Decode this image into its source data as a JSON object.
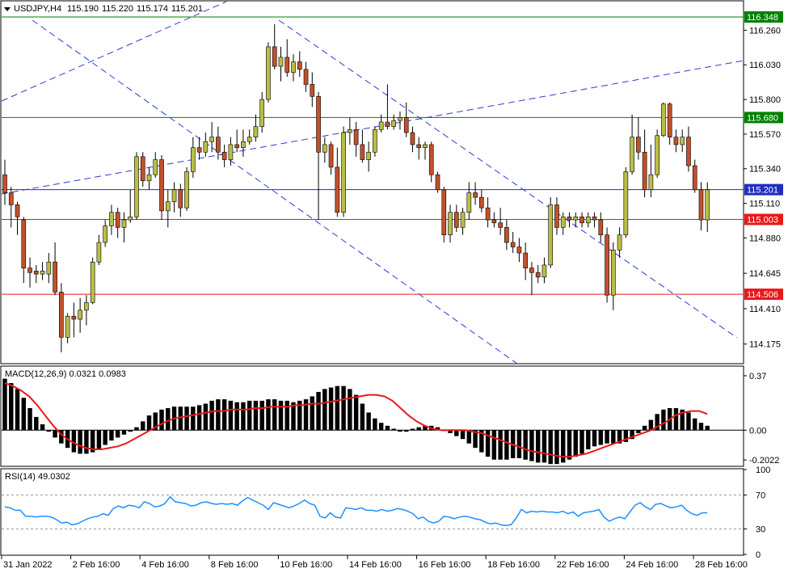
{
  "header": {
    "symbol": "USDJPY,H4",
    "open": "115.190",
    "high": "115.220",
    "low": "115.174",
    "close": "115.201"
  },
  "colors": {
    "bull": "#b9bf45",
    "bear": "#c2512b",
    "wick": "#000000",
    "support_green": "#008000",
    "red_line": "#e8191a",
    "blue_line": "#1f2fbf",
    "trend_dash": "#2b3bd6",
    "macd_hist": "#000000",
    "macd_signal": "#e8191a",
    "rsi_line": "#1e90ff"
  },
  "chart_data": [
    {
      "type": "candlestick",
      "title": "USDJPY,H4",
      "ylim": [
        114.05,
        116.45
      ],
      "y_ticks": [
        "116.260",
        "116.030",
        "115.800",
        "115.570",
        "115.340",
        "115.110",
        "114.880",
        "114.645",
        "114.410",
        "114.175"
      ],
      "x_tick_labels": [
        "31 Jan 2022",
        "2 Feb 16:00",
        "4 Feb 16:00",
        "8 Feb 16:00",
        "10 Feb 16:00",
        "14 Feb 16:00",
        "16 Feb 16:00",
        "18 Feb 16:00",
        "22 Feb 16:00",
        "24 Feb 16:00",
        "28 Feb 16:00"
      ],
      "horizontal_levels": [
        {
          "value": 116.348,
          "label": "116.348",
          "color": "support_green"
        },
        {
          "value": 115.68,
          "label": "115.680",
          "color": "support_green"
        },
        {
          "value": 115.201,
          "label": "115.201",
          "color": "blue_line"
        },
        {
          "value": 115.003,
          "label": "115.003",
          "color": "red_line"
        },
        {
          "value": 114.506,
          "label": "114.506",
          "color": "red_line"
        }
      ],
      "candles": [
        [
          115.3,
          115.4,
          115.1,
          115.18
        ],
        [
          115.18,
          115.22,
          114.95,
          115.1
        ],
        [
          115.1,
          115.12,
          114.9,
          115.02
        ],
        [
          115.0,
          115.02,
          114.58,
          114.68
        ],
        [
          114.68,
          114.75,
          114.55,
          114.65
        ],
        [
          114.66,
          114.7,
          114.58,
          114.64
        ],
        [
          114.64,
          114.72,
          114.6,
          114.66
        ],
        [
          114.64,
          114.78,
          114.58,
          114.72
        ],
        [
          114.72,
          114.85,
          114.5,
          114.52
        ],
        [
          114.52,
          114.58,
          114.12,
          114.22
        ],
        [
          114.22,
          114.38,
          114.18,
          114.36
        ],
        [
          114.36,
          114.45,
          114.22,
          114.34
        ],
        [
          114.34,
          114.48,
          114.25,
          114.4
        ],
        [
          114.4,
          114.5,
          114.3,
          114.45
        ],
        [
          114.45,
          114.75,
          114.44,
          114.72
        ],
        [
          114.72,
          114.9,
          114.7,
          114.85
        ],
        [
          114.85,
          115.0,
          114.82,
          114.96
        ],
        [
          114.96,
          115.1,
          114.9,
          115.05
        ],
        [
          115.05,
          115.08,
          114.88,
          114.95
        ],
        [
          114.95,
          115.05,
          114.85,
          115.0
        ],
        [
          115.0,
          115.2,
          114.98,
          115.02
        ],
        [
          115.02,
          115.45,
          115.0,
          115.42
        ],
        [
          115.42,
          115.45,
          115.22,
          115.26
        ],
        [
          115.26,
          115.35,
          115.2,
          115.3
        ],
        [
          115.3,
          115.45,
          115.28,
          115.4
        ],
        [
          115.4,
          115.43,
          115.0,
          115.06
        ],
        [
          115.06,
          115.2,
          114.95,
          115.12
        ],
        [
          115.12,
          115.25,
          115.05,
          115.2
        ],
        [
          115.2,
          115.24,
          115.02,
          115.08
        ],
        [
          115.08,
          115.35,
          115.06,
          115.32
        ],
        [
          115.32,
          115.55,
          115.28,
          115.48
        ],
        [
          115.48,
          115.55,
          115.4,
          115.45
        ],
        [
          115.45,
          115.58,
          115.42,
          115.52
        ],
        [
          115.52,
          115.65,
          115.45,
          115.55
        ],
        [
          115.55,
          115.62,
          115.4,
          115.45
        ],
        [
          115.45,
          115.5,
          115.35,
          115.4
        ],
        [
          115.4,
          115.55,
          115.36,
          115.5
        ],
        [
          115.5,
          115.6,
          115.45,
          115.48
        ],
        [
          115.48,
          115.6,
          115.42,
          115.52
        ],
        [
          115.52,
          115.6,
          115.5,
          115.55
        ],
        [
          115.55,
          115.7,
          115.52,
          115.62
        ],
        [
          115.62,
          115.85,
          115.58,
          115.8
        ],
        [
          115.8,
          116.18,
          115.78,
          116.15
        ],
        [
          116.15,
          116.3,
          116.0,
          116.02
        ],
        [
          116.02,
          116.15,
          115.92,
          116.08
        ],
        [
          116.08,
          116.2,
          115.95,
          115.98
        ],
        [
          115.98,
          116.1,
          115.92,
          116.05
        ],
        [
          116.05,
          116.12,
          115.95,
          116.0
        ],
        [
          116.0,
          116.05,
          115.85,
          115.9
        ],
        [
          115.9,
          115.98,
          115.75,
          115.82
        ],
        [
          115.82,
          115.85,
          115.0,
          115.45
        ],
        [
          115.45,
          115.55,
          115.38,
          115.5
        ],
        [
          115.5,
          115.52,
          115.3,
          115.35
        ],
        [
          115.35,
          115.48,
          115.02,
          115.05
        ],
        [
          115.05,
          115.62,
          115.02,
          115.58
        ],
        [
          115.58,
          115.68,
          115.5,
          115.6
        ],
        [
          115.6,
          115.65,
          115.42,
          115.5
        ],
        [
          115.5,
          115.6,
          115.38,
          115.4
        ],
        [
          115.4,
          115.52,
          115.32,
          115.45
        ],
        [
          115.45,
          115.62,
          115.42,
          115.6
        ],
        [
          115.6,
          115.7,
          115.58,
          115.65
        ],
        [
          115.65,
          115.9,
          115.6,
          115.62
        ],
        [
          115.62,
          115.7,
          115.6,
          115.66
        ],
        [
          115.66,
          115.72,
          115.6,
          115.68
        ],
        [
          115.68,
          115.78,
          115.55,
          115.58
        ],
        [
          115.58,
          115.62,
          115.45,
          115.5
        ],
        [
          115.5,
          115.55,
          115.4,
          115.48
        ],
        [
          115.48,
          115.52,
          115.4,
          115.5
        ],
        [
          115.5,
          115.52,
          115.25,
          115.3
        ],
        [
          115.3,
          115.32,
          115.18,
          115.2
        ],
        [
          115.2,
          115.22,
          114.85,
          114.9
        ],
        [
          114.9,
          115.1,
          114.85,
          115.05
        ],
        [
          115.05,
          115.1,
          114.92,
          114.95
        ],
        [
          114.95,
          115.08,
          114.9,
          115.05
        ],
        [
          115.05,
          115.25,
          115.0,
          115.18
        ],
        [
          115.18,
          115.25,
          115.1,
          115.15
        ],
        [
          115.15,
          115.2,
          115.05,
          115.08
        ],
        [
          115.08,
          115.15,
          114.95,
          115.0
        ],
        [
          115.0,
          115.05,
          114.95,
          114.98
        ],
        [
          114.98,
          115.08,
          114.9,
          114.95
        ],
        [
          114.95,
          115.0,
          114.8,
          114.85
        ],
        [
          114.85,
          114.92,
          114.78,
          114.82
        ],
        [
          114.82,
          114.88,
          114.72,
          114.78
        ],
        [
          114.78,
          114.85,
          114.6,
          114.68
        ],
        [
          114.68,
          114.72,
          114.5,
          114.65
        ],
        [
          114.65,
          114.7,
          114.58,
          114.62
        ],
        [
          114.62,
          114.75,
          114.58,
          114.7
        ],
        [
          114.7,
          115.15,
          114.68,
          115.1
        ],
        [
          115.1,
          115.15,
          114.9,
          114.95
        ],
        [
          114.95,
          115.05,
          114.9,
          115.02
        ],
        [
          115.02,
          115.05,
          114.95,
          115.0
        ],
        [
          115.0,
          115.05,
          114.95,
          115.02
        ],
        [
          115.02,
          115.05,
          114.95,
          114.98
        ],
        [
          114.98,
          115.05,
          114.95,
          115.02
        ],
        [
          115.02,
          115.05,
          114.95,
          115.0
        ],
        [
          115.0,
          115.05,
          114.85,
          114.9
        ],
        [
          114.9,
          114.95,
          114.45,
          114.5
        ],
        [
          114.5,
          114.85,
          114.4,
          114.8
        ],
        [
          114.8,
          114.95,
          114.75,
          114.9
        ],
        [
          114.9,
          115.35,
          114.88,
          115.32
        ],
        [
          115.32,
          115.7,
          115.3,
          115.55
        ],
        [
          115.55,
          115.68,
          115.4,
          115.45
        ],
        [
          115.45,
          115.6,
          115.15,
          115.2
        ],
        [
          115.2,
          115.5,
          115.15,
          115.3
        ],
        [
          115.3,
          115.6,
          115.28,
          115.56
        ],
        [
          115.56,
          115.78,
          115.55,
          115.77
        ],
        [
          115.77,
          115.78,
          115.5,
          115.55
        ],
        [
          115.55,
          115.6,
          115.45,
          115.5
        ],
        [
          115.5,
          115.6,
          115.45,
          115.55
        ],
        [
          115.55,
          115.62,
          115.32,
          115.36
        ],
        [
          115.36,
          115.4,
          115.18,
          115.2
        ],
        [
          115.2,
          115.25,
          114.93,
          115.0
        ],
        [
          115.0,
          115.25,
          114.92,
          115.2
        ]
      ]
    },
    {
      "type": "bar",
      "title": "MACD(12,26,9) 0.0321 0.0983",
      "ylim": [
        -0.24,
        0.43
      ],
      "y_ticks": [
        "0.37",
        "0.00",
        "-0.2022"
      ],
      "hist": [
        0.35,
        0.32,
        0.28,
        0.22,
        0.15,
        0.09,
        0.04,
        -0.01,
        -0.05,
        -0.09,
        -0.12,
        -0.15,
        -0.16,
        -0.16,
        -0.15,
        -0.13,
        -0.1,
        -0.07,
        -0.05,
        -0.03,
        -0.01,
        0.02,
        0.06,
        0.1,
        0.12,
        0.14,
        0.15,
        0.16,
        0.16,
        0.16,
        0.16,
        0.17,
        0.18,
        0.2,
        0.21,
        0.21,
        0.2,
        0.19,
        0.19,
        0.2,
        0.2,
        0.2,
        0.21,
        0.21,
        0.2,
        0.2,
        0.19,
        0.2,
        0.21,
        0.23,
        0.26,
        0.28,
        0.29,
        0.3,
        0.3,
        0.28,
        0.24,
        0.18,
        0.12,
        0.08,
        0.05,
        0.03,
        0.01,
        -0.01,
        -0.01,
        0.01,
        0.02,
        0.03,
        0.03,
        0.02,
        0.0,
        -0.02,
        -0.04,
        -0.06,
        -0.09,
        -0.12,
        -0.15,
        -0.18,
        -0.2,
        -0.2,
        -0.2,
        -0.19,
        -0.19,
        -0.2,
        -0.21,
        -0.22,
        -0.22,
        -0.23,
        -0.23,
        -0.22,
        -0.2,
        -0.18,
        -0.16,
        -0.13,
        -0.11,
        -0.1,
        -0.09,
        -0.09,
        -0.09,
        -0.08,
        -0.06,
        -0.02,
        0.03,
        0.07,
        0.11,
        0.14,
        0.15,
        0.15,
        0.14,
        0.12,
        0.08,
        0.05,
        0.03
      ],
      "signal": [
        0.32,
        0.3,
        0.27,
        0.23,
        0.17,
        0.1,
        0.03,
        -0.03,
        -0.07,
        -0.1,
        -0.12,
        -0.13,
        -0.13,
        -0.12,
        -0.11,
        -0.09,
        -0.06,
        -0.03,
        0.0,
        0.03,
        0.06,
        0.08,
        0.09,
        0.1,
        0.11,
        0.12,
        0.13,
        0.13,
        0.14,
        0.14,
        0.14,
        0.15,
        0.15,
        0.16,
        0.16,
        0.16,
        0.17,
        0.17,
        0.18,
        0.18,
        0.19,
        0.2,
        0.21,
        0.22,
        0.23,
        0.24,
        0.24,
        0.23,
        0.2,
        0.15,
        0.1,
        0.06,
        0.03,
        0.01,
        0.0,
        0.0,
        0.0,
        0.0,
        -0.01,
        -0.02,
        -0.04,
        -0.06,
        -0.08,
        -0.1,
        -0.12,
        -0.14,
        -0.15,
        -0.16,
        -0.17,
        -0.18,
        -0.18,
        -0.17,
        -0.16,
        -0.14,
        -0.12,
        -0.1,
        -0.08,
        -0.06,
        -0.04,
        -0.02,
        0.0,
        0.03,
        0.06,
        0.1,
        0.12,
        0.13,
        0.13,
        0.11
      ]
    },
    {
      "type": "line",
      "title": "RSI(14) 49.0302",
      "ylim": [
        0,
        100
      ],
      "y_ticks": [
        "100",
        "70",
        "30",
        "0"
      ],
      "levels": [
        70,
        30
      ],
      "values": [
        56,
        55,
        52,
        52,
        45,
        45,
        44,
        45,
        45,
        44,
        41,
        37,
        38,
        35,
        36,
        39,
        42,
        44,
        45,
        48,
        46,
        54,
        57,
        55,
        58,
        57,
        55,
        62,
        60,
        56,
        57,
        60,
        68,
        62,
        61,
        60,
        57,
        58,
        61,
        62,
        60,
        59,
        60,
        59,
        60,
        58,
        63,
        67,
        64,
        61,
        58,
        53,
        61,
        59,
        57,
        55,
        57,
        60,
        64,
        60,
        58,
        45,
        43,
        49,
        44,
        43,
        55,
        54,
        53,
        55,
        52,
        52,
        51,
        53,
        51,
        52,
        54,
        53,
        51,
        48,
        42,
        44,
        39,
        37,
        39,
        45,
        44,
        42,
        44,
        45,
        44,
        42,
        41,
        38,
        36,
        37,
        35,
        34,
        35,
        43,
        53,
        49,
        51,
        50,
        51,
        50,
        50,
        49,
        51,
        48,
        50,
        45,
        49,
        50,
        51,
        53,
        44,
        39,
        42,
        44,
        42,
        50,
        58,
        61,
        56,
        53,
        59,
        60,
        57,
        55,
        56,
        58,
        52,
        48,
        46,
        49,
        49
      ]
    }
  ]
}
